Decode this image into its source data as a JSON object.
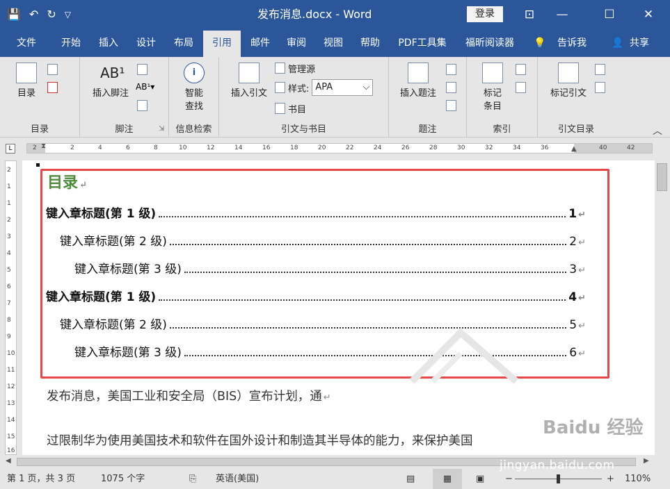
{
  "titlebar": {
    "title": "发布消息.docx  -  Word",
    "login": "登录",
    "qat": {
      "save": "💾",
      "undo": "↶",
      "redo": "↻",
      "customize": "▽"
    },
    "window": {
      "restore_ribbon": "⊡",
      "minimize": "—",
      "maximize": "☐",
      "close": "✕"
    }
  },
  "tabs": [
    {
      "label": "文件"
    },
    {
      "label": "开始"
    },
    {
      "label": "插入"
    },
    {
      "label": "设计"
    },
    {
      "label": "布局"
    },
    {
      "label": "引用"
    },
    {
      "label": "邮件"
    },
    {
      "label": "审阅"
    },
    {
      "label": "视图"
    },
    {
      "label": "帮助"
    },
    {
      "label": "PDF工具集"
    },
    {
      "label": "福昕阅读器"
    },
    {
      "label": "告诉我"
    },
    {
      "label": "共享"
    }
  ],
  "active_tab": "引用",
  "ribbon": {
    "toc_group": {
      "button": "目录",
      "label": "目录"
    },
    "footnote_group": {
      "button": "插入脚注",
      "label": "脚注"
    },
    "research_group": {
      "button_line1": "智能",
      "button_line2": "查找",
      "label": "信息检索"
    },
    "citation_group": {
      "button": "插入引文",
      "manage_sources": "管理源",
      "style_label": "样式:",
      "style_value": "APA",
      "bibliography": "书目",
      "label": "引文与书目"
    },
    "caption_group": {
      "button": "插入题注",
      "label": "题注"
    },
    "index_group": {
      "button_line1": "标记",
      "button_line2": "条目",
      "label": "索引"
    },
    "toa_group": {
      "button": "标记引文",
      "label": "引文目录"
    }
  },
  "ruler": {
    "h_marks": [
      "2",
      "2",
      "4",
      "6",
      "8",
      "10",
      "12",
      "14",
      "16",
      "18",
      "20",
      "22",
      "24",
      "26",
      "28",
      "30",
      "32",
      "34",
      "36",
      "40",
      "42"
    ],
    "v_marks": [
      "2",
      "1",
      "1",
      "2",
      "3",
      "4",
      "5",
      "6",
      "7",
      "8",
      "9",
      "10",
      "11",
      "12",
      "13",
      "14",
      "15",
      "16"
    ]
  },
  "document": {
    "toc_title": "目录",
    "toc_entries": [
      {
        "text": "键入章标题(第  1  级)",
        "page": "1",
        "level": 1
      },
      {
        "text": "键入章标题(第  2  级)",
        "page": "2",
        "level": 2
      },
      {
        "text": "键入章标题(第  3  级)",
        "page": "3",
        "level": 3
      },
      {
        "text": "键入章标题(第  1  级)",
        "page": "4",
        "level": 1
      },
      {
        "text": "键入章标题(第  2  级)",
        "page": "5",
        "level": 2
      },
      {
        "text": "键入章标题(第  3  级)",
        "page": "6",
        "level": 3
      }
    ],
    "para1": "发布消息，美国工业和安全局（BIS）宣布计划，通",
    "para2": "过限制华为使用美国技术和软件在国外设计和制造其半导体的能力，来保护美国",
    "paragraph_mark": "↵"
  },
  "statusbar": {
    "page": "第 1 页，共 3 页",
    "words": "1075 个字",
    "language": "英语(美国)",
    "zoom": "110%",
    "zoom_level": 0.55,
    "zoom_minus": "−",
    "zoom_plus": "+"
  },
  "watermark": {
    "brand": "Baidu 经验",
    "url": "jingyan.baidu.com"
  },
  "colors": {
    "accent": "#2b579a",
    "toc_box": "#e8474a",
    "toc_title": "#4e8a3a"
  }
}
